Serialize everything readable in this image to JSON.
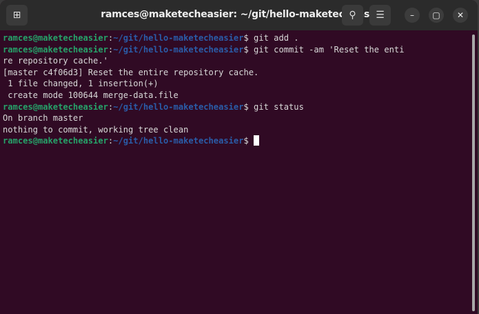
{
  "window": {
    "title": "ramces@maketecheasier: ~/git/hello-maketecheasier"
  },
  "buttons": {
    "new_tab": "new-tab-icon",
    "search": "search-icon",
    "menu": "menu-icon",
    "minimize": "minimize-icon",
    "maximize": "maximize-icon",
    "close": "close-icon"
  },
  "prompt": {
    "user": "ramces@maketecheasier",
    "sep": ":",
    "path": "~/git/hello-maketecheasier",
    "sym": "$"
  },
  "lines": [
    {
      "cmd": " git add ."
    },
    {
      "cmd": " git commit -am 'Reset the enti"
    },
    {
      "out": "re repository cache.'"
    },
    {
      "out": "[master c4f06d3] Reset the entire repository cache."
    },
    {
      "out": " 1 file changed, 1 insertion(+)"
    },
    {
      "out": " create mode 100644 merge-data.file"
    },
    {
      "cmd": " git status"
    },
    {
      "out": "On branch master"
    },
    {
      "out": "nothing to commit, working tree clean"
    },
    {
      "cmd": " "
    }
  ],
  "colors": {
    "background": "#300a24",
    "user": "#26a269",
    "path": "#2a5ca8"
  }
}
